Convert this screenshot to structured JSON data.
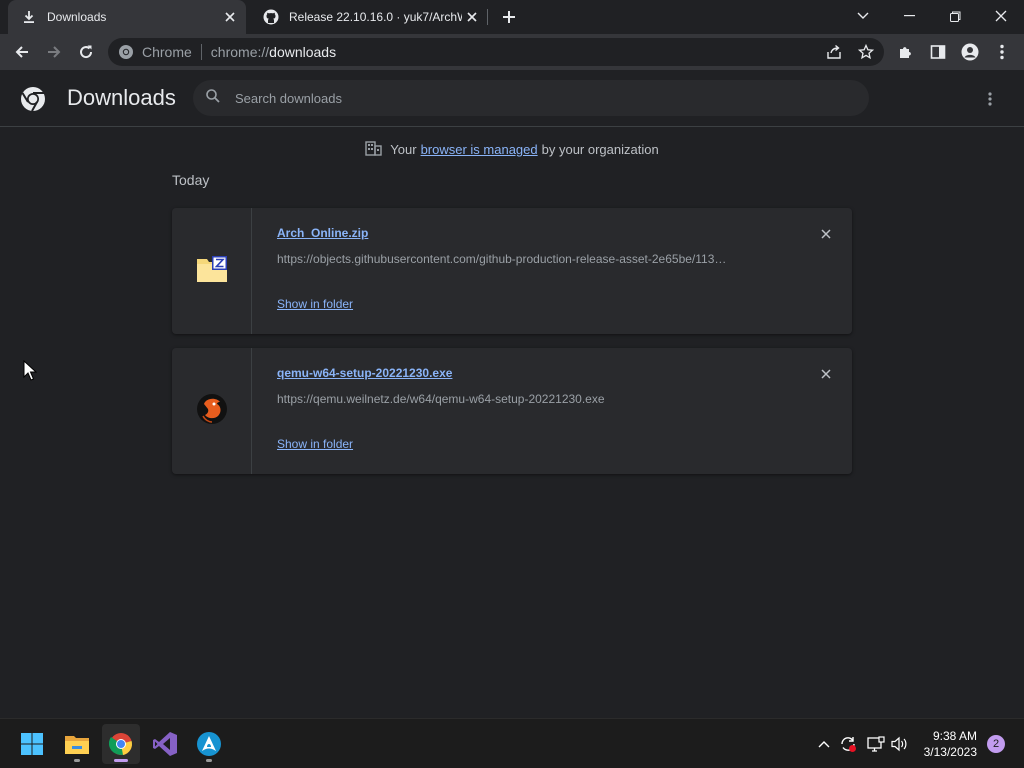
{
  "tabs": [
    {
      "title": "Downloads",
      "icon": "download-icon",
      "active": true
    },
    {
      "title": "Release 22.10.16.0 · yuk7/ArchWSL",
      "icon": "github-icon",
      "active": false
    }
  ],
  "omnibox": {
    "site_chip": "Chrome",
    "url_scheme": "chrome://",
    "url_host": "downloads"
  },
  "page": {
    "title": "Downloads",
    "search_placeholder": "Search downloads",
    "managed": {
      "prefix": "Your",
      "link": "browser is managed",
      "suffix": "by your organization"
    },
    "section_date": "Today",
    "downloads": [
      {
        "filename": "Arch_Online.zip",
        "url": "https://objects.githubusercontent.com/github-production-release-asset-2e65be/113…",
        "action": "Show in folder",
        "icon": "zip-file-icon"
      },
      {
        "filename": "qemu-w64-setup-20221230.exe",
        "url": "https://qemu.weilnetz.de/w64/qemu-w64-setup-20221230.exe",
        "action": "Show in folder",
        "icon": "qemu-icon"
      }
    ]
  },
  "taskbar": {
    "apps": [
      "start-icon",
      "file-explorer-icon",
      "chrome-icon",
      "visual-studio-icon",
      "arch-icon"
    ],
    "clock_time": "9:38 AM",
    "clock_date": "3/13/2023",
    "notification_count": "2"
  },
  "colors": {
    "accent": "#8ab4f8",
    "background": "#202124",
    "card": "#292a2d",
    "taskbar": "#1c1c1c"
  }
}
